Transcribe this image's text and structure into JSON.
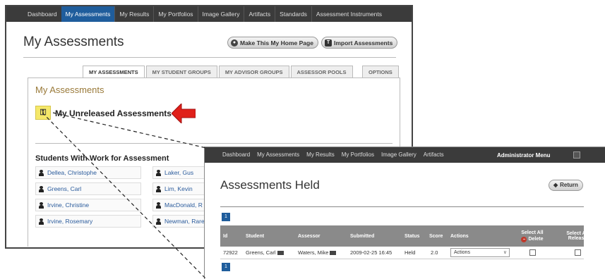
{
  "back_window": {
    "nav": [
      "Dashboard",
      "My Assessments",
      "My Results",
      "My Portfolios",
      "Image Gallery",
      "Artifacts",
      "Standards",
      "Assessment Instruments"
    ],
    "active_nav_index": 1,
    "title": "My Assessments",
    "home_button": "Make This My Home Page",
    "import_button": "Import Assessments",
    "tabs": [
      "MY ASSESSMENTS",
      "MY STUDENT GROUPS",
      "MY ADVISOR GROUPS",
      "ASSESSOR POOLS"
    ],
    "options_tab": "OPTIONS",
    "panel_title": "My Assessments",
    "unreleased_label": "My Unreleased Assessments",
    "students_heading": "Students With Work for Assessment",
    "students_left": [
      "Dellea, Christophe",
      "Greens, Carl",
      "Irvine, Christine",
      "Irvine, Rosemary"
    ],
    "students_right": [
      "Laker, Gus",
      "Lim, Kevin",
      "MacDonald, R",
      "Newman, Rare"
    ]
  },
  "front_window": {
    "nav": [
      "Dashboard",
      "My Assessments",
      "My Results",
      "My Portfolios",
      "Image Gallery",
      "Artifacts"
    ],
    "admin_menu": "Administrator Menu",
    "title": "Assessments Held",
    "return_button": "Return",
    "page_number": "1",
    "columns": {
      "id": "Id",
      "student": "Student",
      "assessor": "Assessor",
      "submitted": "Submitted",
      "status": "Status",
      "score": "Score",
      "actions": "Actions",
      "select_all_delete_top": "Select All",
      "select_all_delete_bottom": "Delete",
      "select_all_release_top": "Select All",
      "select_all_release_bottom": "Release"
    },
    "rows": [
      {
        "id": "72922",
        "student": "Greens, Carl",
        "assessor": "Waters, Mike",
        "submitted": "2009-02-25 16:45",
        "status": "Held",
        "score": "2.0",
        "action": "Actions"
      }
    ]
  },
  "colors": {
    "nav_bg": "#3b3b3b",
    "nav_active": "#1f5d9c",
    "arrow_red": "#e0201a",
    "highlight_yellow": "#f5e86a",
    "panel_title": "#9a7a3a",
    "link_blue": "#2a5b9c"
  },
  "icons": {
    "unreleased": "lock-key-icon",
    "student": "person-icon",
    "arrow": "red-left-arrow"
  }
}
